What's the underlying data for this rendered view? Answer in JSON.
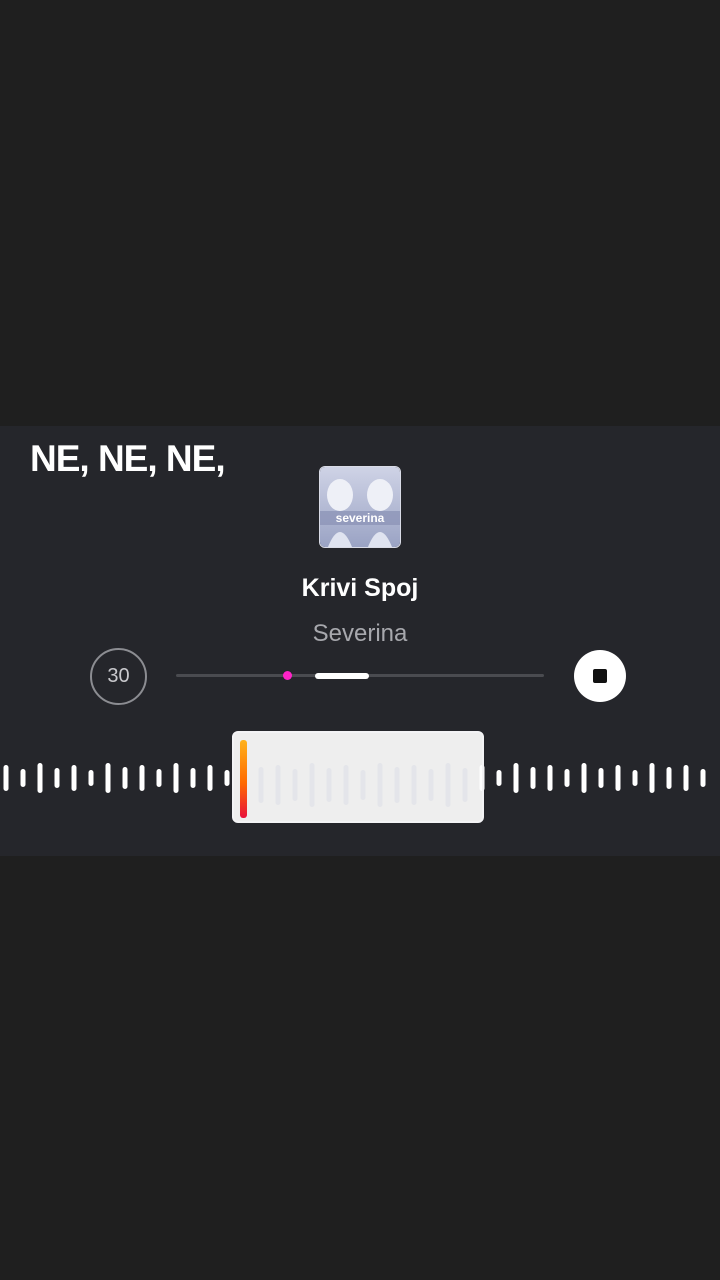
{
  "lyric_line": "NE, NE, NE,",
  "track": {
    "title": "Krivi Spoj",
    "artist": "Severina",
    "album_art_text": "severina"
  },
  "controls": {
    "skip_label": "30",
    "play_state": "playing",
    "stop_icon": "stop-icon"
  },
  "progress": {
    "position_fraction": 0.29,
    "window_start_fraction": 0.38,
    "window_end_fraction": 0.52
  },
  "colors": {
    "progress_dot": "#ff23c8",
    "playhead_top": "#ffb21c",
    "playhead_bottom": "#e8123c"
  }
}
